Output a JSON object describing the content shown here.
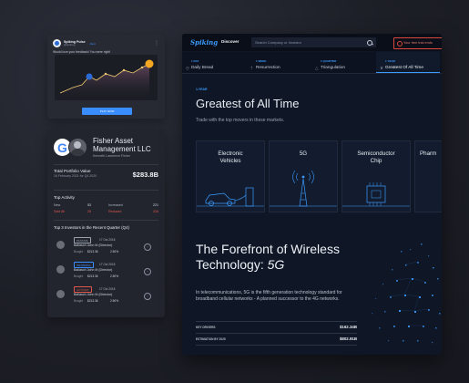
{
  "social_card": {
    "name": "Spiking Pulse",
    "handle": "@spiking",
    "tag": "Alert",
    "text": "Would love your feedback! You were right!",
    "button_label": "PLAY NOW"
  },
  "profile_card": {
    "company_line1": "Fisher Asset",
    "company_line2": "Management LLC",
    "person": "Kenneth Lawrence Fisher",
    "portfolio_label": "Total Portfolio Value",
    "portfolio_date": "16 February 2021 for Q4 2020",
    "portfolio_value": "$283.8B",
    "activity_title": "Top Activity",
    "activity": [
      {
        "left_label": "New",
        "left_value": "53",
        "right_label": "Increased",
        "right_value": "221"
      },
      {
        "left_label": "Sold All",
        "left_value": "25",
        "right_label": "Reduced",
        "right_value": "316"
      }
    ],
    "investors_title": "Top 3 Investors in the Recent Quarter (Q4)",
    "investors": [
      {
        "badge": "PASSIVE",
        "badge_color": "#9aa1ae",
        "date": "17 Oct 2018",
        "name": "Ballasch John M (Director)",
        "bought_label": "Bought",
        "price": "$213.36",
        "pct": "2.50%"
      },
      {
        "badge": "INFORMAL",
        "badge_color": "#3a8dff",
        "date": "17 Oct 2018",
        "name": "Ballasch John M (Director)",
        "bought_label": "Bought",
        "price": "$213.36",
        "pct": "2.50%"
      },
      {
        "badge": "ACTIVIST",
        "badge_color": "#e2574c",
        "date": "17 Oct 2018",
        "name": "Ballasch John M (Director)",
        "bought_label": "Bought",
        "price": "$213.36",
        "pct": "2.50%"
      }
    ]
  },
  "app": {
    "logo": "Spiking",
    "nav_discover": "Discover",
    "search_placeholder": "Search Company or Investor",
    "trial_text": "Your free trial ends",
    "tabs": [
      {
        "sub": "1 DAY",
        "label": "Daily Bread",
        "icon": "◷"
      },
      {
        "sub": "1 WEEK",
        "label": "Resurrection",
        "icon": "†"
      },
      {
        "sub": "1 QUARTER",
        "label": "Triangulation",
        "icon": "△"
      },
      {
        "sub": "1 YEAR",
        "label": "Greatest Of All Time",
        "icon": "♛"
      }
    ],
    "eyebrow": "1-YEAR",
    "hero_title": "Greatest of All Time",
    "hero_subtitle": "Trade with the top movers in these markets.",
    "sectors": [
      {
        "line1": "Electronic",
        "line2": "Vehicles"
      },
      {
        "line1": "5G",
        "line2": ""
      },
      {
        "line1": "Semiconductor",
        "line2": "Chip"
      },
      {
        "line1": "Pharm",
        "line2": ""
      }
    ],
    "section_title_line1": "The Forefront of Wireless",
    "section_title_line2": "Technology:",
    "section_title_em": "5G",
    "description": "In telecommunications, 5G is the fifth generation technology standard for broadband cellular networks - A planned successor to the 4G networks.",
    "stats": [
      {
        "key": "KEY DRIVERS",
        "value": "$162.34B"
      },
      {
        "key": "ESTIMATION BY 2025",
        "value": "$802.91B"
      }
    ]
  },
  "colors": {
    "accent": "#3b9bff",
    "danger": "#e2574c",
    "background": "#1d1f27"
  }
}
